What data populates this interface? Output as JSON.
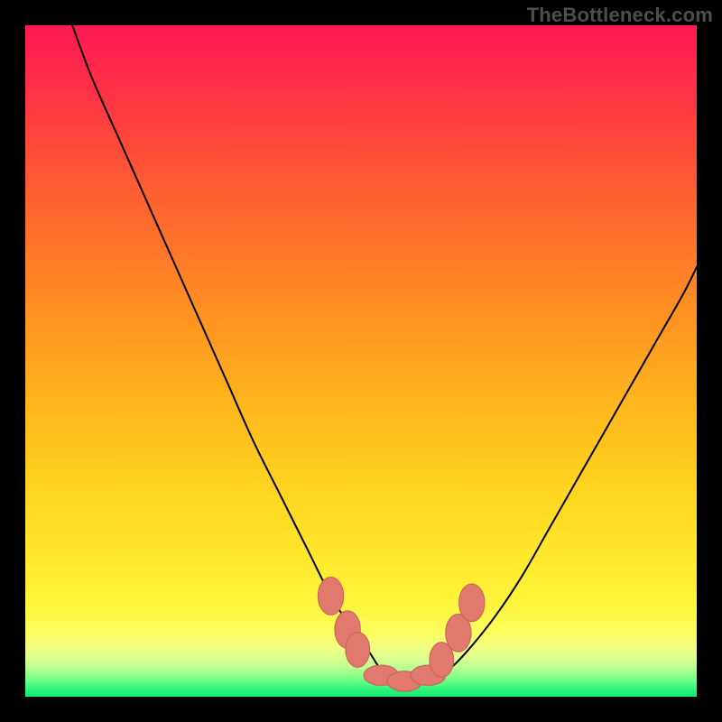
{
  "attribution": "TheBottleneck.com",
  "colors": {
    "black": "#000000",
    "curve_stroke": "#000000",
    "marker_fill": "#e2796f",
    "marker_stroke": "#c96258",
    "gradient_stops": [
      {
        "offset": 0.0,
        "color": "#ff1a52"
      },
      {
        "offset": 0.07,
        "color": "#ff2a4a"
      },
      {
        "offset": 0.18,
        "color": "#ff4a3a"
      },
      {
        "offset": 0.3,
        "color": "#ff6d2c"
      },
      {
        "offset": 0.42,
        "color": "#ff8f22"
      },
      {
        "offset": 0.55,
        "color": "#ffb21e"
      },
      {
        "offset": 0.68,
        "color": "#ffd21e"
      },
      {
        "offset": 0.78,
        "color": "#ffe62a"
      },
      {
        "offset": 0.86,
        "color": "#fff43a"
      },
      {
        "offset": 0.905,
        "color": "#fcff60"
      },
      {
        "offset": 0.925,
        "color": "#f2ff80"
      },
      {
        "offset": 0.945,
        "color": "#d8ff90"
      },
      {
        "offset": 0.96,
        "color": "#b0ff90"
      },
      {
        "offset": 0.975,
        "color": "#70ff88"
      },
      {
        "offset": 0.988,
        "color": "#30f47c"
      },
      {
        "offset": 1.0,
        "color": "#10e874"
      }
    ]
  },
  "chart_data": {
    "type": "line",
    "title": "",
    "xlabel": "",
    "ylabel": "",
    "xlim": [
      0,
      100
    ],
    "ylim": [
      0,
      100
    ],
    "grid": false,
    "series": [
      {
        "name": "bottleneck-curve",
        "x": [
          7,
          10,
          14,
          18,
          22,
          26,
          30,
          34,
          38,
          42,
          45,
          48,
          51,
          53,
          55,
          58,
          60,
          63,
          66,
          70,
          74,
          78,
          82,
          86,
          90,
          94,
          98,
          100
        ],
        "values": [
          100,
          92,
          83,
          74,
          65,
          56,
          47,
          38,
          30,
          22,
          16,
          11,
          7,
          4,
          2.5,
          2,
          2.5,
          4,
          7,
          12,
          18,
          25,
          32,
          39,
          46,
          53,
          60,
          64
        ]
      }
    ],
    "markers": {
      "name": "highlight-points",
      "x": [
        45.5,
        48.0,
        49.5,
        53.0,
        56.5,
        60.0,
        62.0,
        64.5,
        66.5
      ],
      "values": [
        15.0,
        10.0,
        7.0,
        3.2,
        2.3,
        3.2,
        5.5,
        9.5,
        14.0
      ],
      "rx": [
        1.9,
        1.9,
        1.8,
        2.6,
        2.6,
        2.6,
        1.8,
        1.9,
        1.9
      ],
      "ry": [
        2.8,
        2.8,
        2.6,
        1.5,
        1.5,
        1.5,
        2.6,
        2.8,
        2.8
      ]
    }
  }
}
